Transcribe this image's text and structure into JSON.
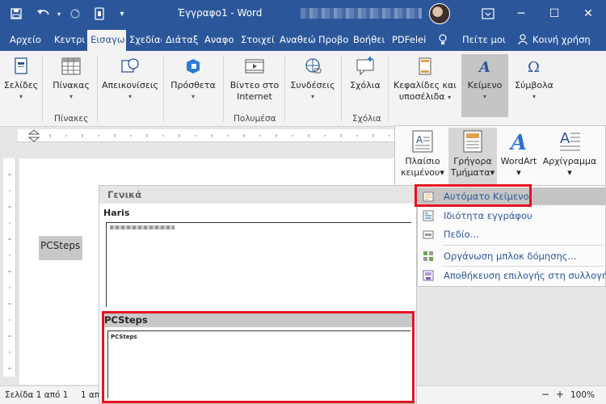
{
  "app": {
    "title": "Έγγραφο1  -  Word"
  },
  "titlebar": {
    "ribbon_toggle_icon": "ribbon-display-icon",
    "min": "─",
    "max": "☐",
    "close": "✕"
  },
  "tabs": [
    {
      "label": "Αρχείο"
    },
    {
      "label": "Κεντρι"
    },
    {
      "label": "Εισαγω"
    },
    {
      "label": "Σχεδίας"
    },
    {
      "label": "Διάταξ"
    },
    {
      "label": "Αναφο"
    },
    {
      "label": "Στοιχεί"
    },
    {
      "label": "Αναθεώ"
    },
    {
      "label": "Προβο"
    },
    {
      "label": "Βοήθει"
    },
    {
      "label": "PDFelei"
    }
  ],
  "tell_me": "Πείτε μοι",
  "share": "Κοινή χρήση",
  "ribbon": {
    "pages": "Σελίδες",
    "table": "Πίνακας",
    "table_group": "Πίνακες",
    "illustrations": "Απεικονίσεις",
    "addins": "Πρόσθετα",
    "video_l1": "Βίντεο στο",
    "video_l2": "Internet",
    "media_group": "Πολυμέσα",
    "links": "Συνδέσεις",
    "comments": "Σχόλια",
    "comments_group": "Σχόλια",
    "header_l1": "Κεφαλίδες και",
    "header_l2": "υποσέλιδα",
    "text": "Κείμενο",
    "symbols": "Σύμβολα"
  },
  "text_panel": {
    "textbox_l1": "Πλαίσιο",
    "textbox_l2": "κειμένου",
    "quickparts_l1": "Γρήγορα",
    "quickparts_l2": "Τμήματα",
    "wordart": "WordArt",
    "dropcap": "Αρχίγραμμα"
  },
  "document": {
    "text": "PCSteps"
  },
  "gallery": {
    "header": "Γενικά",
    "entry1_name": "Haris",
    "entry2_name": "PCSteps",
    "entry2_preview": "PCSteps"
  },
  "menu": [
    {
      "label": "Αυτόματο Κείμενο",
      "icon": "autotext-icon"
    },
    {
      "label": "Ιδιότητα εγγράφου",
      "icon": "document-property-icon"
    },
    {
      "label": "Πεδίο...",
      "icon": "field-icon"
    },
    {
      "label": "Οργάνωση μπλοκ δόμησης...",
      "icon": "building-blocks-icon"
    },
    {
      "label": "Αποθήκευση επιλογής στη συλλογή",
      "icon": "save-to-gallery-icon"
    }
  ],
  "status": {
    "page": "Σελίδα 1 από 1",
    "page_partial": "1 απ",
    "zoom": "100%"
  },
  "colors": {
    "accent": "#2b579a",
    "highlight_box": "#e81123"
  }
}
